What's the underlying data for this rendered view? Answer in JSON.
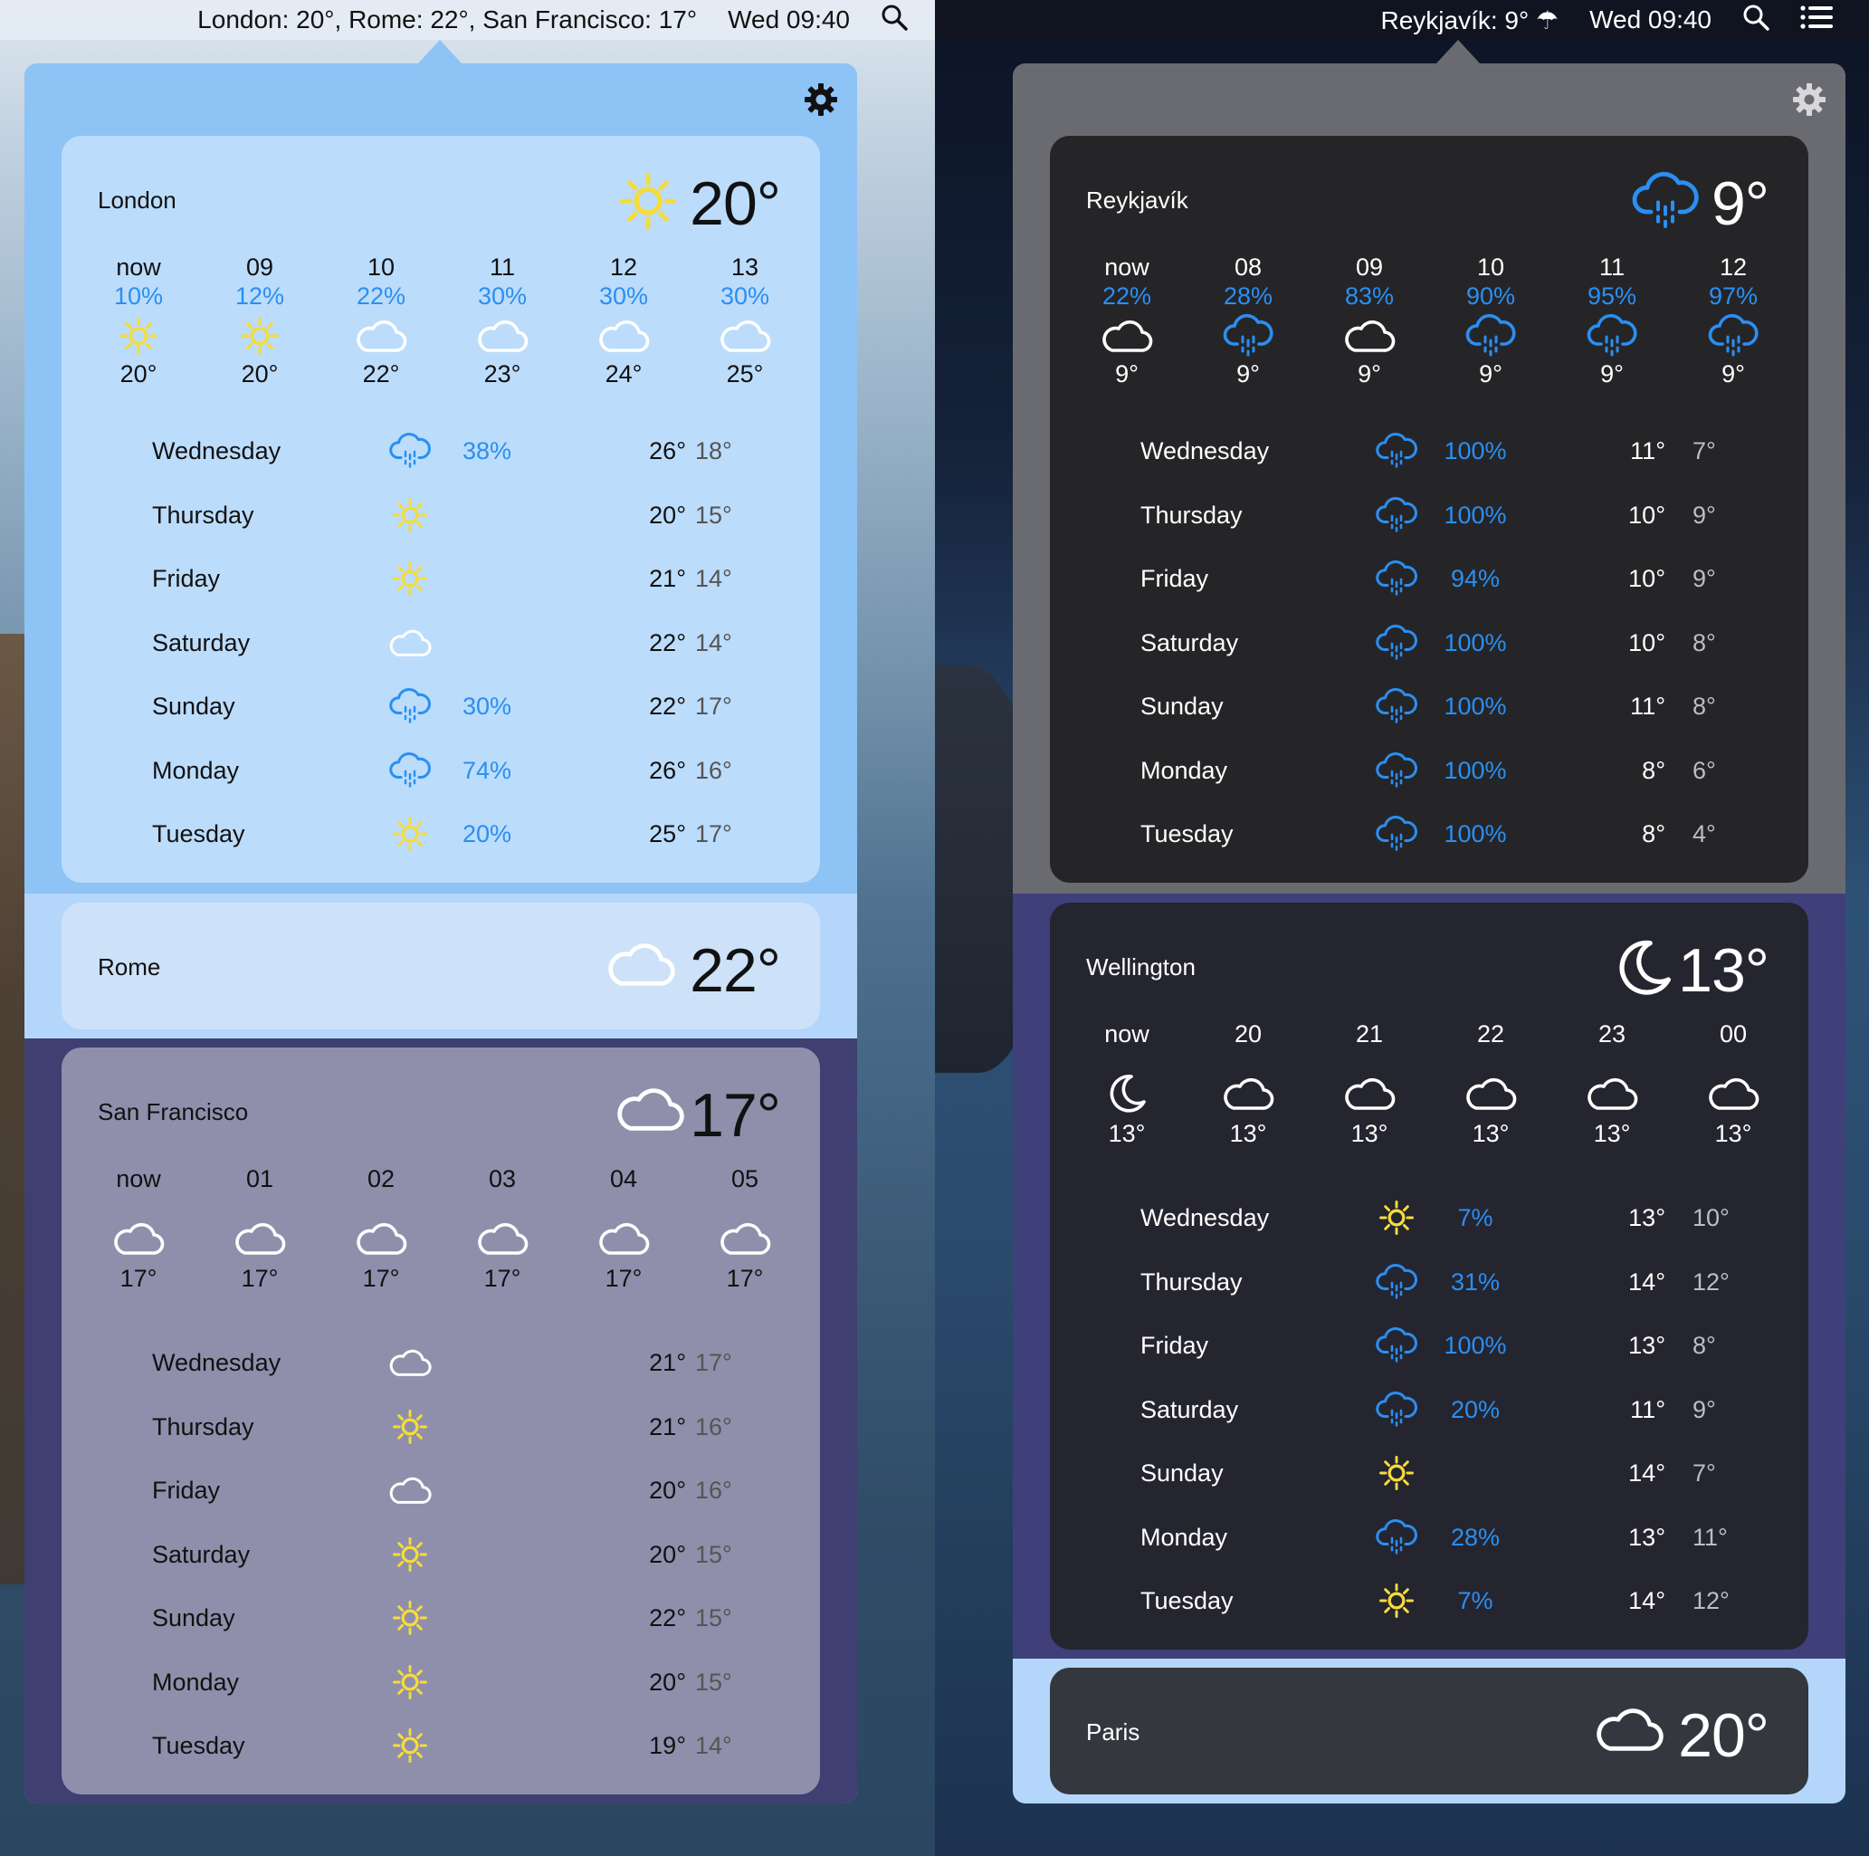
{
  "left": {
    "menubar": {
      "status": "London: 20°, Rome: 22°, San Francisco: 17°",
      "clock": "Wed 09:40"
    },
    "cities": [
      {
        "name": "London",
        "temp": "20°",
        "icon": "sun-icon",
        "hourly": [
          {
            "time": "now",
            "pct": "10%",
            "icon": "sun-icon",
            "temp": "20°"
          },
          {
            "time": "09",
            "pct": "12%",
            "icon": "sun-icon",
            "temp": "20°"
          },
          {
            "time": "10",
            "pct": "22%",
            "icon": "cloud-icon",
            "temp": "22°"
          },
          {
            "time": "11",
            "pct": "30%",
            "icon": "cloud-icon",
            "temp": "23°"
          },
          {
            "time": "12",
            "pct": "30%",
            "icon": "cloud-icon",
            "temp": "24°"
          },
          {
            "time": "13",
            "pct": "30%",
            "icon": "cloud-icon",
            "temp": "25°"
          }
        ],
        "daily": [
          {
            "day": "Wednesday",
            "icon": "rain-icon",
            "pct": "38%",
            "high": "26°",
            "low": "18°"
          },
          {
            "day": "Thursday",
            "icon": "sun-icon",
            "pct": "",
            "high": "20°",
            "low": "15°"
          },
          {
            "day": "Friday",
            "icon": "sun-icon",
            "pct": "",
            "high": "21°",
            "low": "14°"
          },
          {
            "day": "Saturday",
            "icon": "cloud-icon",
            "pct": "",
            "high": "22°",
            "low": "14°"
          },
          {
            "day": "Sunday",
            "icon": "rain-icon",
            "pct": "30%",
            "high": "22°",
            "low": "17°"
          },
          {
            "day": "Monday",
            "icon": "rain-icon",
            "pct": "74%",
            "high": "26°",
            "low": "16°"
          },
          {
            "day": "Tuesday",
            "icon": "sun-icon",
            "pct": "20%",
            "high": "25°",
            "low": "17°"
          }
        ]
      },
      {
        "name": "Rome",
        "temp": "22°",
        "icon": "cloud-icon"
      },
      {
        "name": "San Francisco",
        "temp": "17°",
        "icon": "cloud-icon",
        "hourly": [
          {
            "time": "now",
            "pct": "",
            "icon": "cloud-icon",
            "temp": "17°"
          },
          {
            "time": "01",
            "pct": "",
            "icon": "cloud-icon",
            "temp": "17°"
          },
          {
            "time": "02",
            "pct": "",
            "icon": "cloud-icon",
            "temp": "17°"
          },
          {
            "time": "03",
            "pct": "",
            "icon": "cloud-icon",
            "temp": "17°"
          },
          {
            "time": "04",
            "pct": "",
            "icon": "cloud-icon",
            "temp": "17°"
          },
          {
            "time": "05",
            "pct": "",
            "icon": "cloud-icon",
            "temp": "17°"
          }
        ],
        "daily": [
          {
            "day": "Wednesday",
            "icon": "cloud-icon",
            "pct": "",
            "high": "21°",
            "low": "17°"
          },
          {
            "day": "Thursday",
            "icon": "sun-icon",
            "pct": "",
            "high": "21°",
            "low": "16°"
          },
          {
            "day": "Friday",
            "icon": "cloud-icon",
            "pct": "",
            "high": "20°",
            "low": "16°"
          },
          {
            "day": "Saturday",
            "icon": "sun-icon",
            "pct": "",
            "high": "20°",
            "low": "15°"
          },
          {
            "day": "Sunday",
            "icon": "sun-icon",
            "pct": "",
            "high": "22°",
            "low": "15°"
          },
          {
            "day": "Monday",
            "icon": "sun-icon",
            "pct": "",
            "high": "20°",
            "low": "15°"
          },
          {
            "day": "Tuesday",
            "icon": "sun-icon",
            "pct": "",
            "high": "19°",
            "low": "14°"
          }
        ]
      }
    ]
  },
  "right": {
    "menubar": {
      "status": "Reykjavík: 9° ☂",
      "clock": "Wed 09:40"
    },
    "cities": [
      {
        "name": "Reykjavík",
        "temp": "9°",
        "icon": "rain-icon",
        "hourly": [
          {
            "time": "now",
            "pct": "22%",
            "icon": "cloud-icon",
            "temp": "9°"
          },
          {
            "time": "08",
            "pct": "28%",
            "icon": "rain-icon",
            "temp": "9°"
          },
          {
            "time": "09",
            "pct": "83%",
            "icon": "cloud-icon",
            "temp": "9°"
          },
          {
            "time": "10",
            "pct": "90%",
            "icon": "rain-icon",
            "temp": "9°"
          },
          {
            "time": "11",
            "pct": "95%",
            "icon": "rain-icon",
            "temp": "9°"
          },
          {
            "time": "12",
            "pct": "97%",
            "icon": "rain-icon",
            "temp": "9°"
          }
        ],
        "daily": [
          {
            "day": "Wednesday",
            "icon": "rain-icon",
            "pct": "100%",
            "high": "11°",
            "low": "7°"
          },
          {
            "day": "Thursday",
            "icon": "rain-icon",
            "pct": "100%",
            "high": "10°",
            "low": "9°"
          },
          {
            "day": "Friday",
            "icon": "rain-icon",
            "pct": "94%",
            "high": "10°",
            "low": "9°"
          },
          {
            "day": "Saturday",
            "icon": "rain-icon",
            "pct": "100%",
            "high": "10°",
            "low": "8°"
          },
          {
            "day": "Sunday",
            "icon": "rain-icon",
            "pct": "100%",
            "high": "11°",
            "low": "8°"
          },
          {
            "day": "Monday",
            "icon": "rain-icon",
            "pct": "100%",
            "high": "8°",
            "low": "6°"
          },
          {
            "day": "Tuesday",
            "icon": "rain-icon",
            "pct": "100%",
            "high": "8°",
            "low": "4°"
          }
        ]
      },
      {
        "name": "Wellington",
        "temp": "13°",
        "icon": "moon-icon",
        "hourly": [
          {
            "time": "now",
            "pct": "",
            "icon": "moon-icon",
            "temp": "13°"
          },
          {
            "time": "20",
            "pct": "",
            "icon": "cloud-icon",
            "temp": "13°"
          },
          {
            "time": "21",
            "pct": "",
            "icon": "cloud-icon",
            "temp": "13°"
          },
          {
            "time": "22",
            "pct": "",
            "icon": "cloud-icon",
            "temp": "13°"
          },
          {
            "time": "23",
            "pct": "",
            "icon": "cloud-icon",
            "temp": "13°"
          },
          {
            "time": "00",
            "pct": "",
            "icon": "cloud-icon",
            "temp": "13°"
          }
        ],
        "daily": [
          {
            "day": "Wednesday",
            "icon": "sun-icon",
            "pct": "7%",
            "high": "13°",
            "low": "10°"
          },
          {
            "day": "Thursday",
            "icon": "rain-icon",
            "pct": "31%",
            "high": "14°",
            "low": "12°"
          },
          {
            "day": "Friday",
            "icon": "rain-icon",
            "pct": "100%",
            "high": "13°",
            "low": "8°"
          },
          {
            "day": "Saturday",
            "icon": "rain-icon",
            "pct": "20%",
            "high": "11°",
            "low": "9°"
          },
          {
            "day": "Sunday",
            "icon": "sun-icon",
            "pct": "",
            "high": "14°",
            "low": "7°"
          },
          {
            "day": "Monday",
            "icon": "rain-icon",
            "pct": "28%",
            "high": "13°",
            "low": "11°"
          },
          {
            "day": "Tuesday",
            "icon": "sun-icon",
            "pct": "7%",
            "high": "14°",
            "low": "12°"
          }
        ]
      },
      {
        "name": "Paris",
        "temp": "20°",
        "icon": "cloud-icon"
      }
    ]
  },
  "colors": {
    "accent": "#2a8ff2",
    "sun": "#f5dc3a",
    "rainblue": "#2a8ff2"
  }
}
